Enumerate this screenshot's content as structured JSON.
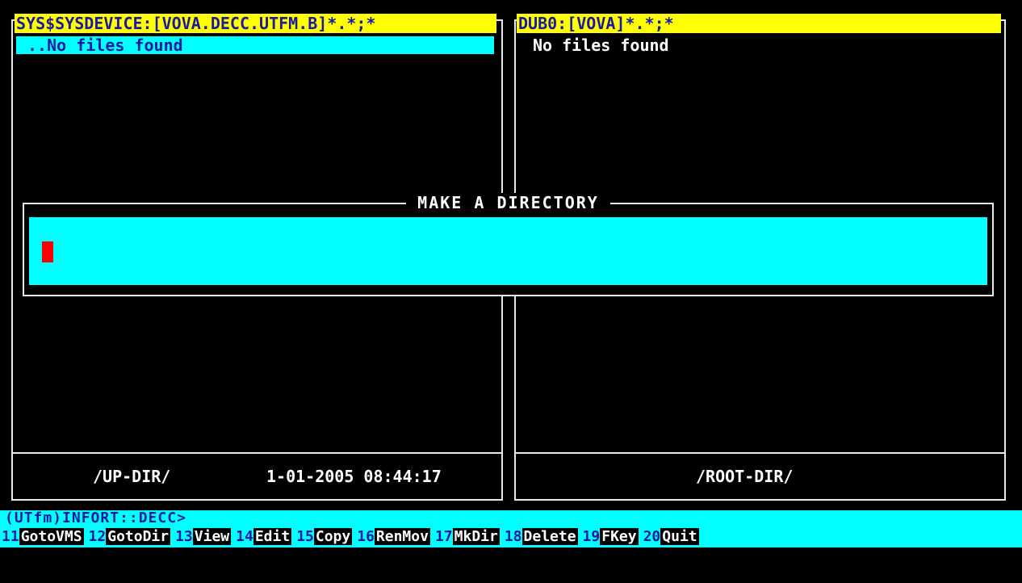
{
  "left_panel": {
    "path": "SYS$SYSDEVICE:[VOVA.DECC.UTFM.B]*.*;*",
    "selected_item": "..No files found",
    "footer_left": "/UP-DIR/",
    "footer_right": "1-01-2005 08:44:17"
  },
  "right_panel": {
    "path": "DUB0:[VOVA]*.*;*",
    "message": "No files found",
    "footer": "/ROOT-DIR/"
  },
  "dialog": {
    "title": "MAKE A DIRECTORY",
    "value": ""
  },
  "command_line": "(UTfm)INFORT::DECC>",
  "function_keys": [
    {
      "num": "11",
      "label": "GotoVMS"
    },
    {
      "num": "12",
      "label": "GotoDir"
    },
    {
      "num": "13",
      "label": "View"
    },
    {
      "num": "14",
      "label": "Edit"
    },
    {
      "num": "15",
      "label": "Copy"
    },
    {
      "num": "16",
      "label": "RenMov"
    },
    {
      "num": "17",
      "label": "MkDir"
    },
    {
      "num": "18",
      "label": "Delete"
    },
    {
      "num": "19",
      "label": "FKey"
    },
    {
      "num": "20",
      "label": "Quit"
    }
  ],
  "colors": {
    "header_bg": "#ffff00",
    "selection_bg": "#00ffff",
    "cursor": "#ff0000",
    "background": "#000000"
  }
}
